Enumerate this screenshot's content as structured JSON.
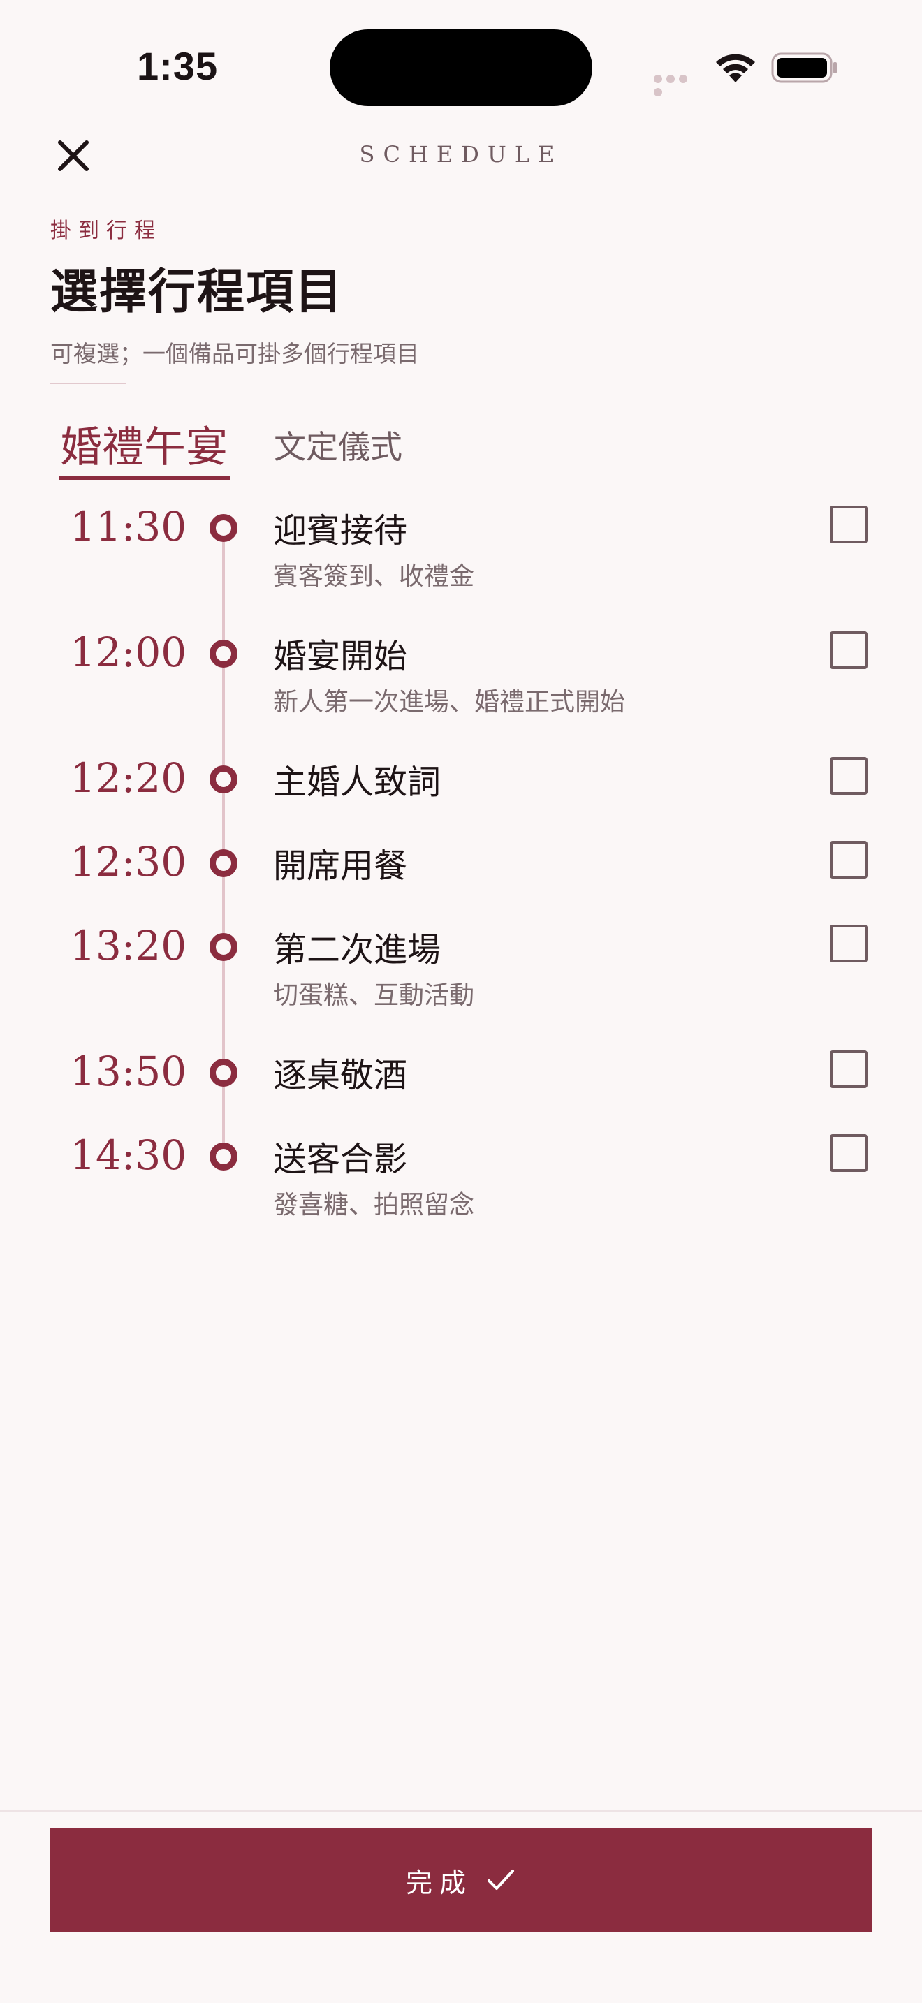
{
  "status_bar": {
    "time": "1:35",
    "icons": [
      "signal-icon",
      "wifi-icon",
      "battery-icon"
    ]
  },
  "header": {
    "title": "SCHEDULE",
    "close_icon": "close-icon"
  },
  "intro": {
    "eyebrow": "掛到行程",
    "title": "選擇行程項目",
    "subtitle": "可複選；一個備品可掛多個行程項目"
  },
  "tabs": [
    {
      "label": "婚禮午宴",
      "active": true
    },
    {
      "label": "文定儀式",
      "active": false
    }
  ],
  "schedule": [
    {
      "time": "11:30",
      "name": "迎賓接待",
      "desc": "賓客簽到、收禮金",
      "checked": false
    },
    {
      "time": "12:00",
      "name": "婚宴開始",
      "desc": "新人第一次進場、婚禮正式開始",
      "checked": false
    },
    {
      "time": "12:20",
      "name": "主婚人致詞",
      "desc": "",
      "checked": false
    },
    {
      "time": "12:30",
      "name": "開席用餐",
      "desc": "",
      "checked": false
    },
    {
      "time": "13:20",
      "name": "第二次進場",
      "desc": "切蛋糕、互動活動",
      "checked": false
    },
    {
      "time": "13:50",
      "name": "逐桌敬酒",
      "desc": "",
      "checked": false
    },
    {
      "time": "14:30",
      "name": "送客合影",
      "desc": "發喜糖、拍照留念",
      "checked": false
    }
  ],
  "footer": {
    "done_label": "完成",
    "done_icon": "checkmark-icon"
  },
  "colors": {
    "accent": "#8b2c3f",
    "background": "#fbf7f7",
    "muted_text": "#7a6a6e"
  }
}
